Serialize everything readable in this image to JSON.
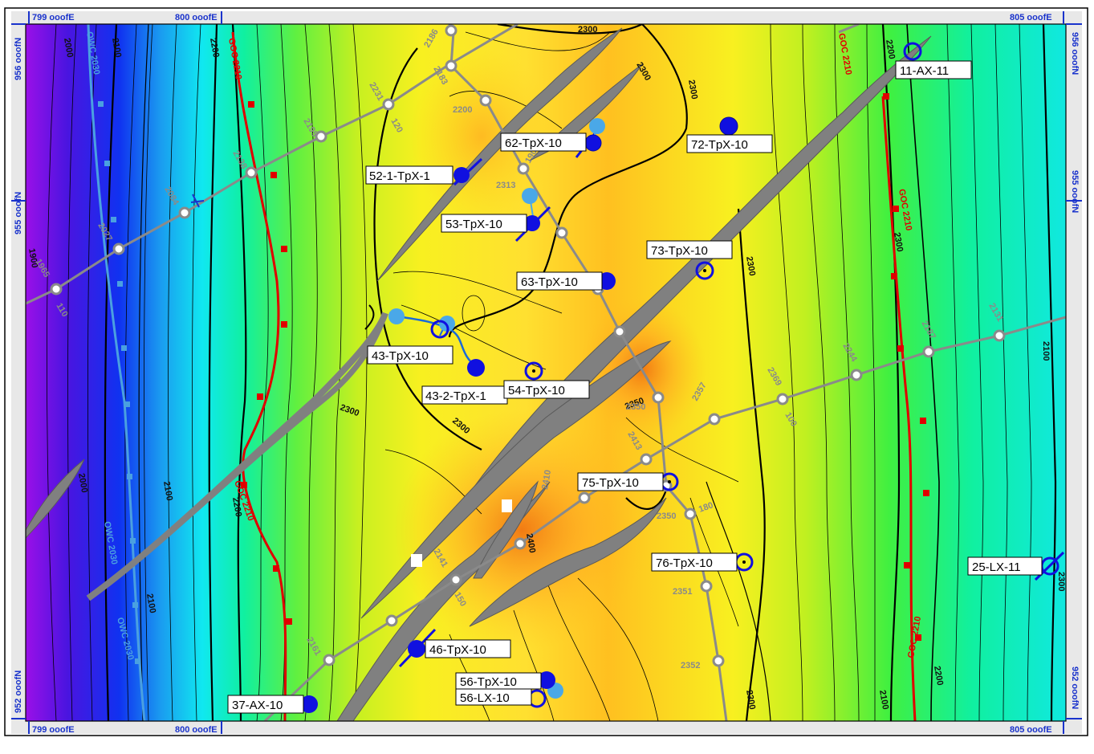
{
  "colors": {
    "fault": "#808080",
    "goc": "#e00000",
    "owc": "#4aa0e0",
    "seismic": "#8a8a8a",
    "coord_label": "#1a33cc",
    "well_fill": "#1010e0",
    "well_faded": "#4aa8e8"
  },
  "grid_labels": {
    "x_left": "799 ooofE",
    "x_mid": "800 ooofE",
    "x_right": "805 ooofE",
    "y_top": "956 ooofN",
    "y_mid": "955 ooofN",
    "y_bottom": "952 ooofN"
  },
  "contour_labels": [
    "2000",
    "2100",
    "2200",
    "2300",
    "2300",
    "2300",
    "2300",
    "2300",
    "2300",
    "2200",
    "2100",
    "2100",
    "2000",
    "2100",
    "2200",
    "2300",
    "2300",
    "2200",
    "2100",
    "2300",
    "1900",
    "2350",
    "2400"
  ],
  "goc_label": "GOC 2210",
  "owc_label": "OWC 2030",
  "seismic_labels": [
    "2186",
    "2183",
    "2231",
    "120",
    "2195",
    "2138",
    "2084",
    "2027",
    "1965",
    "110",
    "2200",
    "2313",
    "190",
    "2161",
    "2141",
    "150",
    "2410",
    "2413",
    "2350",
    "2357",
    "2369",
    "100",
    "2244",
    "2187",
    "2131",
    "2350",
    "180",
    "2351",
    "2352"
  ],
  "wells": [
    {
      "name": "11-AX-11",
      "type": "open"
    },
    {
      "name": "62-TpX-10",
      "type": "deviated"
    },
    {
      "name": "72-TpX-10",
      "type": "filled"
    },
    {
      "name": "52-1-TpX-1",
      "type": "deviated"
    },
    {
      "name": "53-TpX-10",
      "type": "deviated"
    },
    {
      "name": "73-TpX-10",
      "type": "open"
    },
    {
      "name": "63-TpX-10",
      "type": "filled"
    },
    {
      "name": "43-TpX-10",
      "type": "open"
    },
    {
      "name": "43-2-TpX-1",
      "type": "filled"
    },
    {
      "name": "54-TpX-10",
      "type": "open"
    },
    {
      "name": "75-TpX-10",
      "type": "open"
    },
    {
      "name": "76-TpX-10",
      "type": "open"
    },
    {
      "name": "25-LX-11",
      "type": "open"
    },
    {
      "name": "46-TpX-10",
      "type": "deviated"
    },
    {
      "name": "56-TpX-10",
      "type": "filled"
    },
    {
      "name": "56-LX-10",
      "type": "open"
    },
    {
      "name": "37-AX-10",
      "type": "filled"
    }
  ]
}
